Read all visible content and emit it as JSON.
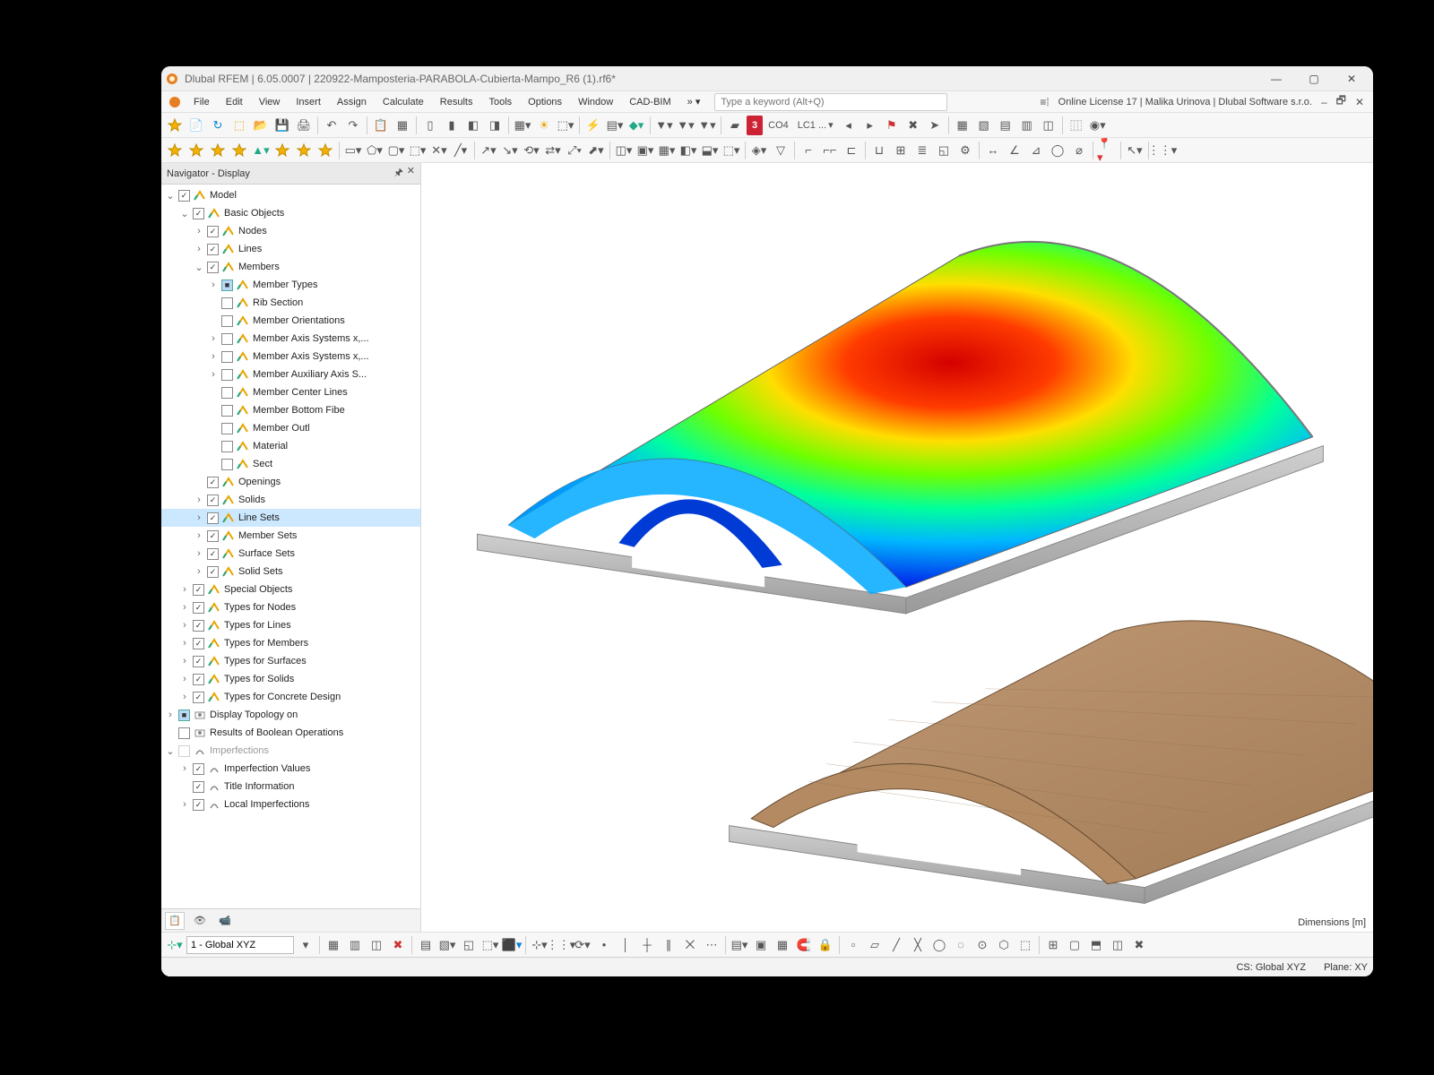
{
  "window": {
    "title": "Dlubal RFEM | 6.05.0007 | 220922-Mamposteria-PARABOLA-Cubierta-Mampo_R6 (1).rf6*",
    "license_text": "Online License 17 | Malika Urinova | Dlubal Software s.r.o."
  },
  "menus": [
    "File",
    "Edit",
    "View",
    "Insert",
    "Assign",
    "Calculate",
    "Results",
    "Tools",
    "Options",
    "Window",
    "CAD-BIM"
  ],
  "search_placeholder": "Type a keyword (Alt+Q)",
  "combo_co": "CO4",
  "combo_lc": "LC1 ...",
  "red_badge": "3",
  "navigator": {
    "title": "Navigator - Display",
    "tree": [
      {
        "d": 0,
        "exp": "v",
        "cb": "on",
        "ic": "obj",
        "label": "Model"
      },
      {
        "d": 1,
        "exp": "v",
        "cb": "on",
        "ic": "obj",
        "label": "Basic Objects"
      },
      {
        "d": 2,
        "exp": ">",
        "cb": "on",
        "ic": "obj",
        "label": "Nodes"
      },
      {
        "d": 2,
        "exp": ">",
        "cb": "on",
        "ic": "obj",
        "label": "Lines"
      },
      {
        "d": 2,
        "exp": "v",
        "cb": "on",
        "ic": "obj",
        "label": "Members"
      },
      {
        "d": 3,
        "exp": ">",
        "cb": "blue",
        "ic": "obj",
        "label": "Member Types"
      },
      {
        "d": 3,
        "exp": " ",
        "cb": "off",
        "ic": "obj",
        "label": "Rib Section"
      },
      {
        "d": 3,
        "exp": " ",
        "cb": "off",
        "ic": "obj",
        "label": "Member Orientations"
      },
      {
        "d": 3,
        "exp": ">",
        "cb": "off",
        "ic": "obj",
        "label": "Member Axis Systems x,..."
      },
      {
        "d": 3,
        "exp": ">",
        "cb": "off",
        "ic": "obj",
        "label": "Member Axis Systems x,..."
      },
      {
        "d": 3,
        "exp": ">",
        "cb": "off",
        "ic": "obj",
        "label": "Member Auxiliary Axis S..."
      },
      {
        "d": 3,
        "exp": " ",
        "cb": "off",
        "ic": "obj",
        "label": "Member Center Lines"
      },
      {
        "d": 3,
        "exp": " ",
        "cb": "off",
        "ic": "obj",
        "label": "Member Bottom Fibe"
      },
      {
        "d": 3,
        "exp": " ",
        "cb": "off",
        "ic": "obj",
        "label": "Member Outl"
      },
      {
        "d": 3,
        "exp": " ",
        "cb": "off",
        "ic": "obj",
        "label": "Material"
      },
      {
        "d": 3,
        "exp": " ",
        "cb": "off",
        "ic": "obj",
        "label": "Sect"
      },
      {
        "d": 2,
        "exp": " ",
        "cb": "on",
        "ic": "obj",
        "label": "Openings"
      },
      {
        "d": 2,
        "exp": ">",
        "cb": "on",
        "ic": "obj",
        "label": "Solids"
      },
      {
        "d": 2,
        "exp": ">",
        "cb": "on",
        "ic": "obj",
        "label": "Line Sets",
        "sel": true
      },
      {
        "d": 2,
        "exp": ">",
        "cb": "on",
        "ic": "obj",
        "label": "Member Sets"
      },
      {
        "d": 2,
        "exp": ">",
        "cb": "on",
        "ic": "obj",
        "label": "Surface Sets"
      },
      {
        "d": 2,
        "exp": ">",
        "cb": "on",
        "ic": "obj",
        "label": "Solid Sets"
      },
      {
        "d": 1,
        "exp": ">",
        "cb": "on",
        "ic": "obj",
        "label": "Special Objects"
      },
      {
        "d": 1,
        "exp": ">",
        "cb": "on",
        "ic": "obj",
        "label": "Types for Nodes"
      },
      {
        "d": 1,
        "exp": ">",
        "cb": "on",
        "ic": "obj",
        "label": "Types for Lines"
      },
      {
        "d": 1,
        "exp": ">",
        "cb": "on",
        "ic": "obj",
        "label": "Types for Members"
      },
      {
        "d": 1,
        "exp": ">",
        "cb": "on",
        "ic": "obj",
        "label": "Types for Surfaces"
      },
      {
        "d": 1,
        "exp": ">",
        "cb": "on",
        "ic": "obj",
        "label": "Types for Solids"
      },
      {
        "d": 1,
        "exp": ">",
        "cb": "on",
        "ic": "obj",
        "label": "Types for Concrete Design"
      },
      {
        "d": 0,
        "exp": ">",
        "cb": "blue",
        "ic": "disp",
        "label": "Display Topology on"
      },
      {
        "d": 0,
        "exp": " ",
        "cb": "off",
        "ic": "disp",
        "label": "Results of Boolean Operations"
      },
      {
        "d": 0,
        "exp": "v",
        "cb": "dim",
        "ic": "imp",
        "label": "Imperfections"
      },
      {
        "d": 1,
        "exp": ">",
        "cb": "on",
        "ic": "imp",
        "label": "Imperfection Values"
      },
      {
        "d": 1,
        "exp": " ",
        "cb": "on",
        "ic": "imp",
        "label": "Title Information"
      },
      {
        "d": 1,
        "exp": ">",
        "cb": "on",
        "ic": "imp",
        "label": "Local Imperfections"
      }
    ]
  },
  "coord_system": "1 - Global XYZ",
  "status": {
    "cs": "CS: Global XYZ",
    "plane": "Plane: XY"
  },
  "dimensions_label": "Dimensions [m]"
}
